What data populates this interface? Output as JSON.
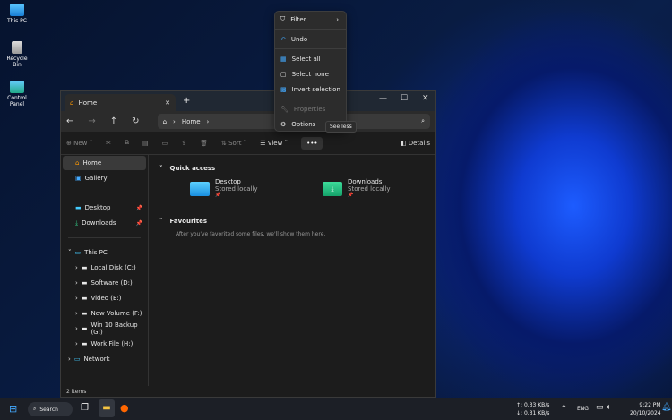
{
  "desktop": {
    "icons": [
      {
        "label": "This PC"
      },
      {
        "label": "Recycle Bin"
      },
      {
        "label": "Control Panel"
      }
    ]
  },
  "explorer": {
    "tab_title": "Home",
    "address": {
      "crumbs": [
        "Home"
      ]
    },
    "toolbar": {
      "new": "New",
      "sort": "Sort",
      "view": "View",
      "more": "•••",
      "details": "Details"
    },
    "sidebar": {
      "top": [
        {
          "label": "Home"
        },
        {
          "label": "Gallery"
        }
      ],
      "pinned": [
        {
          "label": "Desktop"
        },
        {
          "label": "Downloads"
        }
      ],
      "this_pc": "This PC",
      "drives": [
        {
          "label": "Local Disk (C:)"
        },
        {
          "label": "Software (D:)"
        },
        {
          "label": "Video (E:)"
        },
        {
          "label": "New Volume (F:)"
        },
        {
          "label": "Win 10 Backup (G:)"
        },
        {
          "label": "Work File (H:)"
        }
      ],
      "network": "Network"
    },
    "quick_access": {
      "title": "Quick access",
      "items": [
        {
          "name": "Desktop",
          "sub": "Stored locally"
        },
        {
          "name": "Downloads",
          "sub": "Stored locally"
        }
      ]
    },
    "favourites": {
      "title": "Favourites",
      "empty": "After you've favorited some files, we'll show them here."
    },
    "status": "2 items"
  },
  "menu": {
    "items": [
      "Filter",
      "Undo",
      "Select all",
      "Select none",
      "Invert selection",
      "Properties",
      "Options"
    ]
  },
  "tooltip": "See less",
  "taskbar": {
    "search": "Search",
    "upload": "0.33 KB/s",
    "download": "0.31 KB/s",
    "lang": "ENG",
    "time": "9:22 PM",
    "date": "20/10/2024"
  }
}
